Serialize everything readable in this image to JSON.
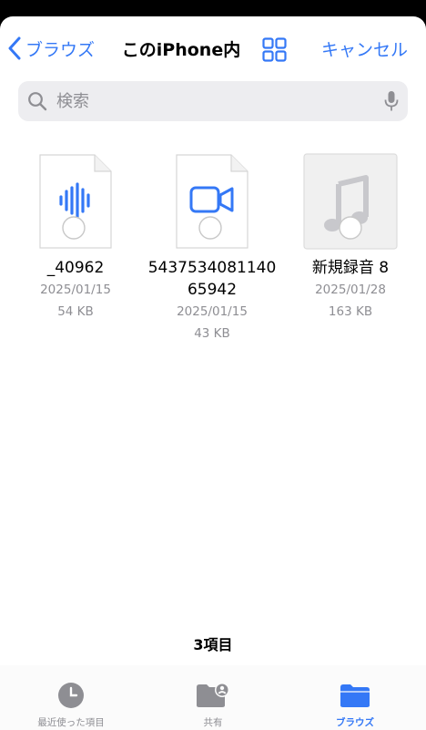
{
  "nav": {
    "back_label": "ブラウズ",
    "title": "このiPhone内",
    "cancel_label": "キャンセル"
  },
  "search": {
    "placeholder": "検索"
  },
  "files": [
    {
      "name": "_40962",
      "date": "2025/01/15",
      "size": "54 KB",
      "icon": "audio-waveform-icon"
    },
    {
      "name": "543753408114065942",
      "date": "2025/01/15",
      "size": "43 KB",
      "icon": "video-camera-icon"
    },
    {
      "name": "新規録音 8",
      "date": "2025/01/28",
      "size": "163 KB",
      "icon": "music-note-icon"
    }
  ],
  "footer": {
    "count": "3項目"
  },
  "tabs": [
    {
      "label": "最近使った項目",
      "icon": "clock-icon",
      "active": false
    },
    {
      "label": "共有",
      "icon": "shared-folder-icon",
      "active": false
    },
    {
      "label": "ブラウズ",
      "icon": "folder-icon",
      "active": true
    }
  ],
  "colors": {
    "accent": "#3478f6",
    "secondary_text": "#8e8e93",
    "search_bg": "#ededf0"
  }
}
